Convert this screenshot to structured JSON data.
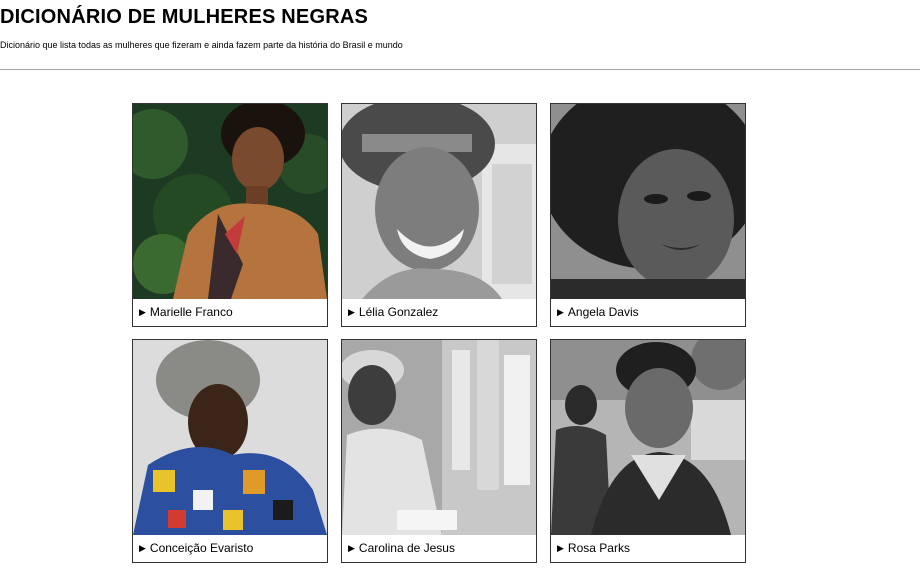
{
  "header": {
    "title": "DICIONÁRIO DE MULHERES NEGRAS",
    "subtitle": "Dicionário que lista todas as mulheres que fizeram e ainda fazem parte da história do Brasil e mundo"
  },
  "cards": [
    {
      "name": "Marielle Franco",
      "marker": "▶",
      "icon": "play-triangle-icon"
    },
    {
      "name": "Lélia Gonzalez",
      "marker": "▶",
      "icon": "play-triangle-icon"
    },
    {
      "name": "Angela Davis",
      "marker": "▶",
      "icon": "play-triangle-icon"
    },
    {
      "name": "Conceição Evaristo",
      "marker": "▶",
      "icon": "play-triangle-icon"
    },
    {
      "name": "Carolina de Jesus",
      "marker": "▶",
      "icon": "play-triangle-icon"
    },
    {
      "name": "Rosa Parks",
      "marker": "▶",
      "icon": "play-triangle-icon"
    }
  ],
  "colors": {
    "divider": "#a6a6a6",
    "card_border": "#333333"
  }
}
